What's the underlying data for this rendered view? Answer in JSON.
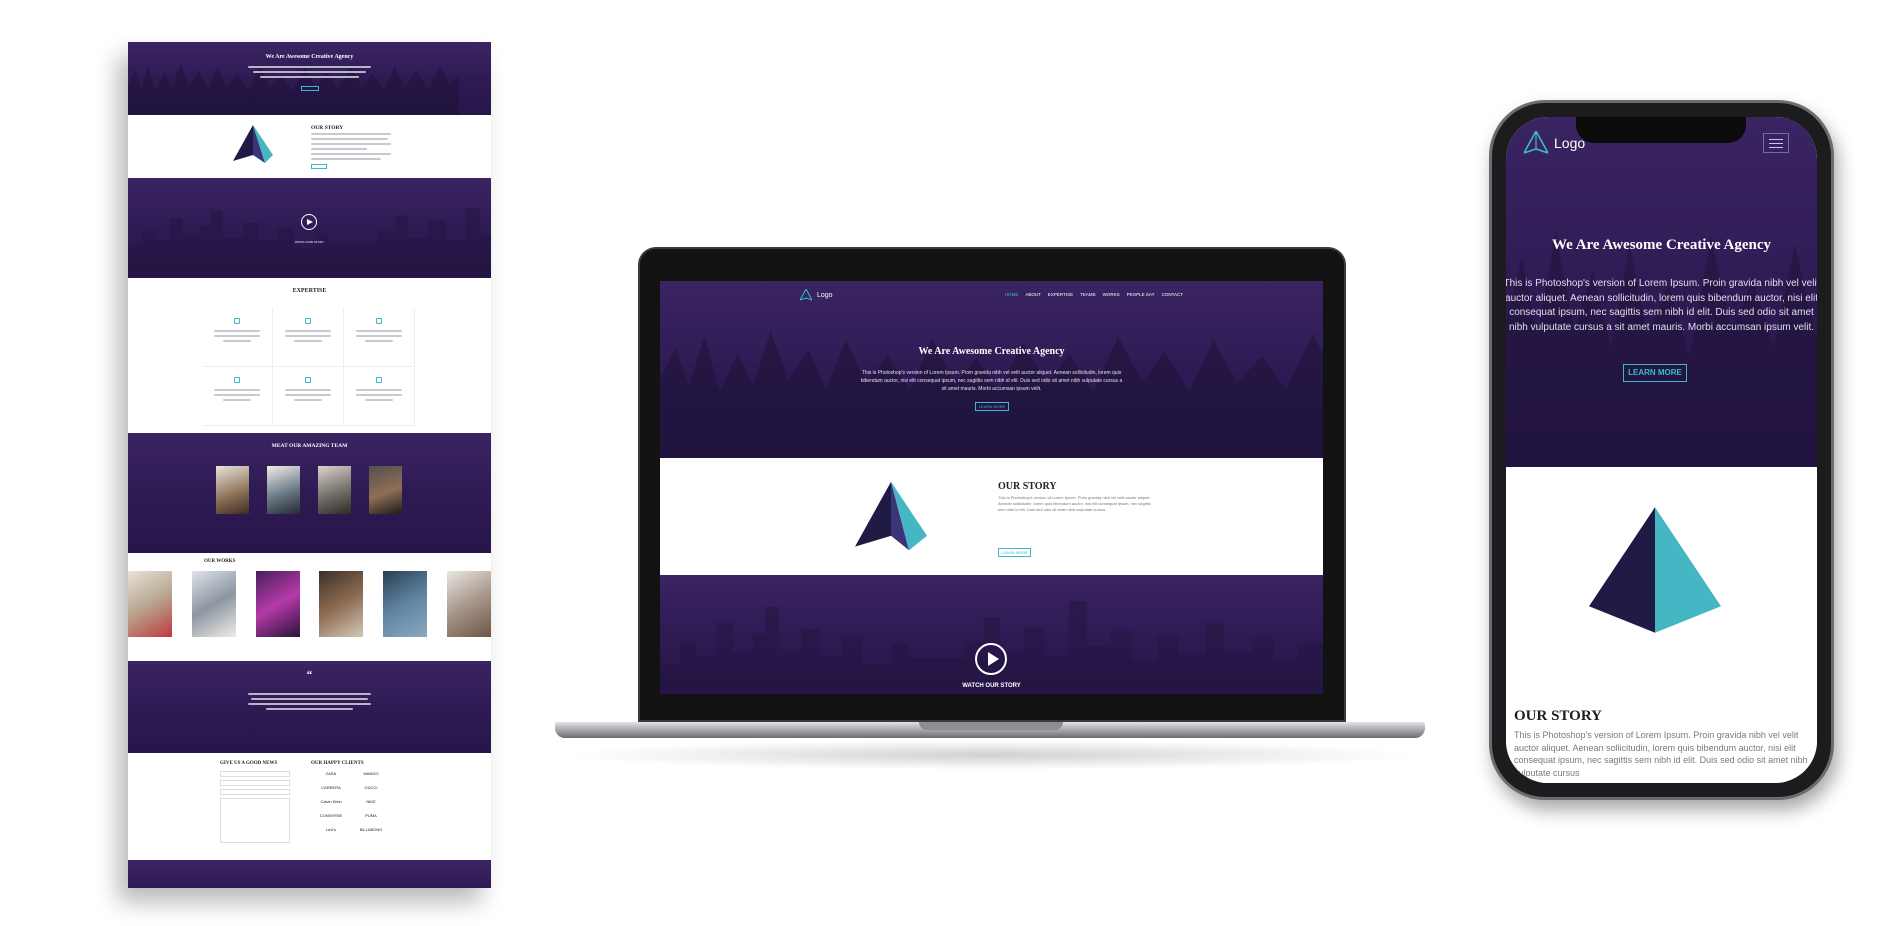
{
  "colors": {
    "primary_purple": "#2d1a52",
    "accent_teal": "#3fb9c9",
    "dark_navy": "#1f1b44"
  },
  "hero": {
    "title": "We Are Awesome Creative Agency",
    "text": "This is Photoshop's version of Lorem Ipsum. Proin gravida nibh vel velit auctor aliquet. Aenean sollicitudin, lorem quis bibendum auctor, nisi elit consequat ipsum, nec sagittis sem nibh id elit. Duis sed odio sit amet nibh vulputate cursus a sit amet mauris. Morbi accumsan ipsum velit.",
    "button": "LEARN MORE"
  },
  "nav": {
    "logo": "Logo",
    "items": [
      "HOME",
      "ABOUT",
      "EXPERTISE",
      "TEAMS",
      "WORKS",
      "PEOPLE SAY",
      "CONTACT"
    ]
  },
  "story": {
    "title": "OUR STORY",
    "text": "This is Photoshop's version of Lorem Ipsum. Proin gravida nibh vel velit auctor aliquet. Aenean sollicitudin, lorem quis bibendum auctor, nisi elit consequat ipsum, nec sagittis sem nibh id elit. Duis sed odio sit amet nibh vulputate cursus",
    "button": "LEARN MORE"
  },
  "video": {
    "caption": "WATCH OUR STORY"
  },
  "long_page": {
    "expertise_title": "EXPERTISE",
    "team_title": "MEAT OUR AMAZING TEAM",
    "works_title": "OUR WORKS",
    "quote_mark": "“",
    "contact_title": "GIVE US A GOOD NEWS",
    "clients_title": "OUR HAPPY CLIENTS",
    "clients": [
      "ZARA",
      "MANGO",
      "CARRERA",
      "GUCCI",
      "Calvin Klein",
      "NIKE",
      "CONVERSE",
      "PUMA",
      "Levi's",
      "BILLABONG"
    ]
  },
  "phone_menu_icon": "hamburger-icon",
  "play_icon": "play-icon"
}
